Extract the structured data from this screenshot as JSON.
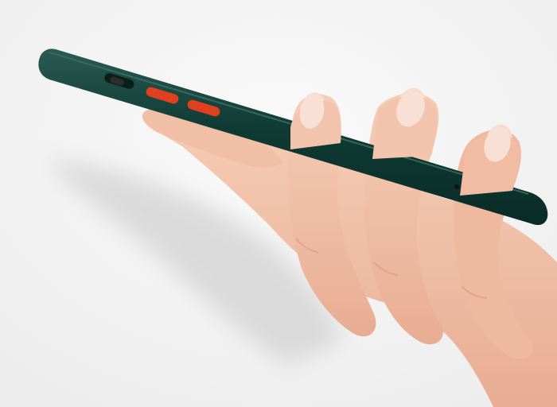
{
  "scene": {
    "subject": "hand-holding-phone-case-side-view",
    "colors": {
      "background": "#f3f3f3",
      "case": "#0f3b34",
      "case_highlight": "#2a5a52",
      "buttons": "#e0401f",
      "skin": "#f0c2aa",
      "skin_shadow": "#d99e85",
      "nail": "#f6dcd0"
    }
  }
}
